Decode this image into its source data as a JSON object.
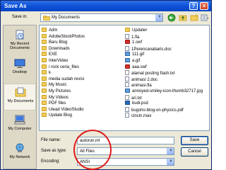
{
  "window": {
    "title": "Save As",
    "help_glyph": "?",
    "close_glyph": "×"
  },
  "save_in": {
    "label": "Save in:",
    "value": "My Documents",
    "dropdown_glyph": "▼"
  },
  "places": [
    {
      "label": "My Recent Documents",
      "icon": "recent-documents-icon"
    },
    {
      "label": "Desktop",
      "icon": "desktop-icon"
    },
    {
      "label": "My Documents",
      "icon": "my-documents-icon",
      "active": true
    },
    {
      "label": "My Computer",
      "icon": "my-computer-icon"
    },
    {
      "label": "My Network",
      "icon": "my-network-icon"
    }
  ],
  "files": {
    "column_1": [
      {
        "name": "Adm",
        "type": "folder"
      },
      {
        "name": "AdobeStockPhotos",
        "type": "folder"
      },
      {
        "name": "Baru Blog",
        "type": "folder"
      },
      {
        "name": "Downloads",
        "type": "folder"
      },
      {
        "name": "EXE",
        "type": "folder"
      },
      {
        "name": "InterVideo",
        "type": "folder"
      },
      {
        "name": "i rock ceria_files",
        "type": "folder"
      },
      {
        "name": "k",
        "type": "folder"
      },
      {
        "name": "media sudah revisi",
        "type": "folder"
      },
      {
        "name": "My Music",
        "type": "folder"
      },
      {
        "name": "My Pictures",
        "type": "folder"
      },
      {
        "name": "My Videos",
        "type": "folder"
      },
      {
        "name": "PDF files",
        "type": "folder"
      },
      {
        "name": "Ulead VideoStudio",
        "type": "folder"
      },
      {
        "name": "Update Blog",
        "type": "folder"
      }
    ],
    "column_2": [
      {
        "name": "Updater",
        "type": "folder"
      },
      {
        "name": "1.fla",
        "type": "file-doc"
      },
      {
        "name": "1.swf",
        "type": "flash"
      },
      {
        "name": "1Perencanabaris.doc",
        "type": "file-doc"
      },
      {
        "name": "111.gif",
        "type": "image"
      },
      {
        "name": "a.gif",
        "type": "image"
      },
      {
        "name": "aaa.swf",
        "type": "flash"
      },
      {
        "name": "alamat posting flash.txt",
        "type": "text"
      },
      {
        "name": "animasi 2.doc",
        "type": "file-doc"
      },
      {
        "name": "animasi.fla",
        "type": "file-doc"
      },
      {
        "name": "annoyed-smiley-icon-thumb32717.jpg",
        "type": "image"
      },
      {
        "name": "ari.txt",
        "type": "text"
      },
      {
        "name": "budi.psd",
        "type": "psd"
      },
      {
        "name": "bugsho-blog-on-physics.pdf",
        "type": "file-doc"
      },
      {
        "name": "cincin.max",
        "type": "file-doc"
      }
    ]
  },
  "form": {
    "file_name_label": "File name:",
    "file_name_value": "autorun.inf",
    "save_as_type_label": "Save as type:",
    "save_as_type_value": "All Files",
    "encoding_label": "Encoding:",
    "encoding_value": "ANSI",
    "dropdown_glyph": "▼"
  },
  "buttons": {
    "save": "Save",
    "cancel": "Cancel"
  },
  "colors": {
    "titlebar": "#0b4fd6",
    "dialog_bg": "#ece9d8",
    "annotation_circle": "#e01b1b"
  }
}
